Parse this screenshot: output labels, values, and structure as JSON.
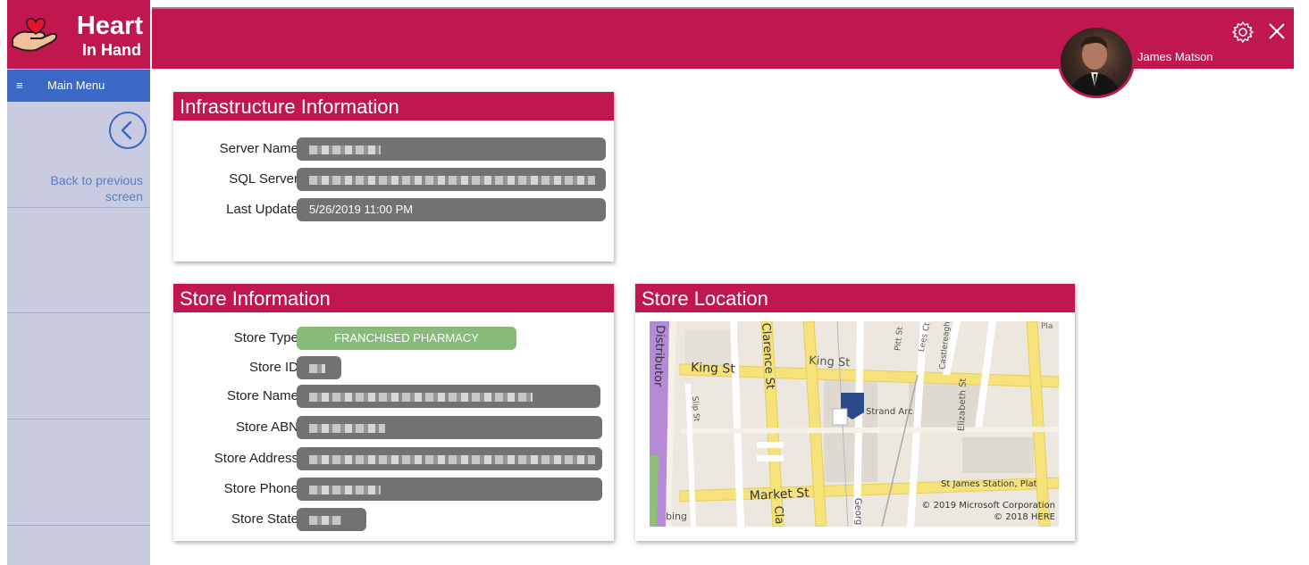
{
  "app": {
    "logo_line1": "Heart",
    "logo_line2": "In Hand",
    "main_menu_label": "Main Menu",
    "back_label": "Back to previous screen"
  },
  "header": {
    "user_name": "James Matson"
  },
  "infrastructure": {
    "title": "Infrastructure Information",
    "rows": [
      {
        "label": "Server Name",
        "value": ""
      },
      {
        "label": "SQL Server",
        "value": ""
      },
      {
        "label": "Last Update",
        "value": "5/26/2019 11:00 PM"
      }
    ]
  },
  "store_info": {
    "title": "Store Information",
    "rows": [
      {
        "label": "Store Type",
        "value": "FRANCHISED PHARMACY"
      },
      {
        "label": "Store ID",
        "value": ""
      },
      {
        "label": "Store Name",
        "value": ""
      },
      {
        "label": "Store ABN",
        "value": ""
      },
      {
        "label": "Store Address",
        "value": ""
      },
      {
        "label": "Store Phone",
        "value": ""
      },
      {
        "label": "Store State",
        "value": ""
      }
    ]
  },
  "store_location": {
    "title": "Store Location",
    "map_labels": {
      "king_st": "King St",
      "king_st_2": "King St",
      "market_st": "Market St",
      "clarence_st": "Clarence St",
      "pitt_st": "Pitt St",
      "lees_ct": "Lees Ct",
      "castlereagh": "Castlereagh",
      "elizabeth_st": "Elizabeth St",
      "slip_st": "Slip St",
      "distributor": "Distributor",
      "strand_arc": "Strand Arc",
      "st_james": "St James Station, Plat",
      "pla": "Pla",
      "cla": "Cla",
      "georg": "Georg"
    },
    "copyright_1": "© 2019 Microsoft Corporation",
    "copyright_2": "© 2018 HERE",
    "bing": "bing"
  },
  "colors": {
    "brand": "#c0174f",
    "menu_blue": "#3b67c6",
    "sidebar": "#c9cbe0",
    "field_gray": "#727272",
    "badge_green": "#86bb7a"
  },
  "icons": {
    "logo": "heart-hand-icon",
    "menu": "hamburger-icon",
    "back": "chevron-left-icon",
    "settings": "gear-icon",
    "close": "close-icon",
    "map_pin": "map-pin-icon"
  }
}
